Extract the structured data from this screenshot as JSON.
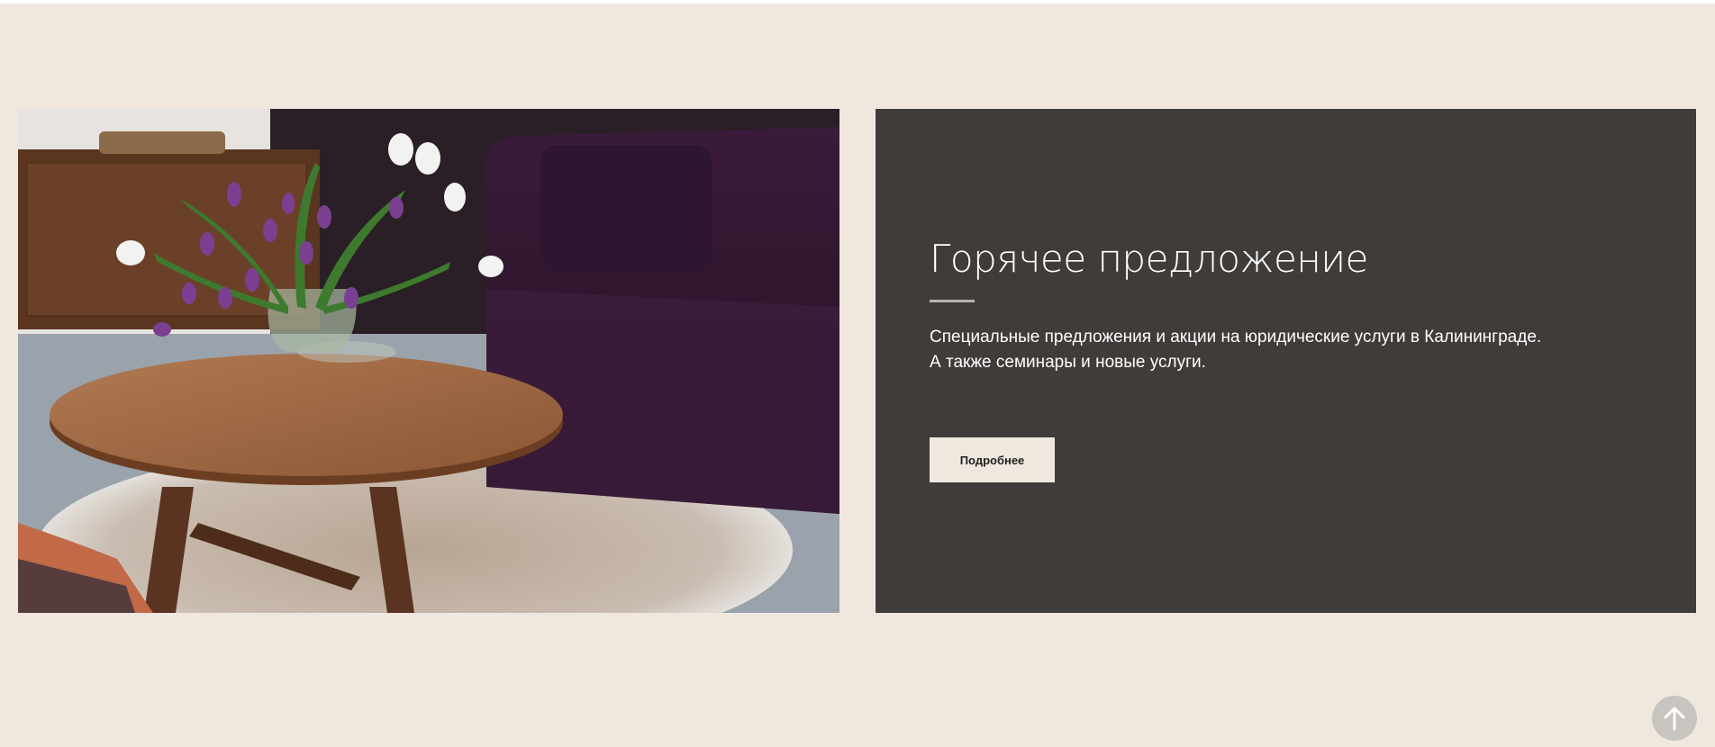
{
  "promo": {
    "title": "Горячее предложение",
    "description_lines": [
      "Специальные предложения и акции на юридические услуги в Калининграде.",
      "А также семинары и новые услуги."
    ],
    "button_label": "Подробнее"
  },
  "scroll_top": {
    "icon": "arrow-up-icon"
  },
  "colors": {
    "background": "#f0e8df",
    "panel": "#403c3a",
    "button": "#f0e8df"
  }
}
